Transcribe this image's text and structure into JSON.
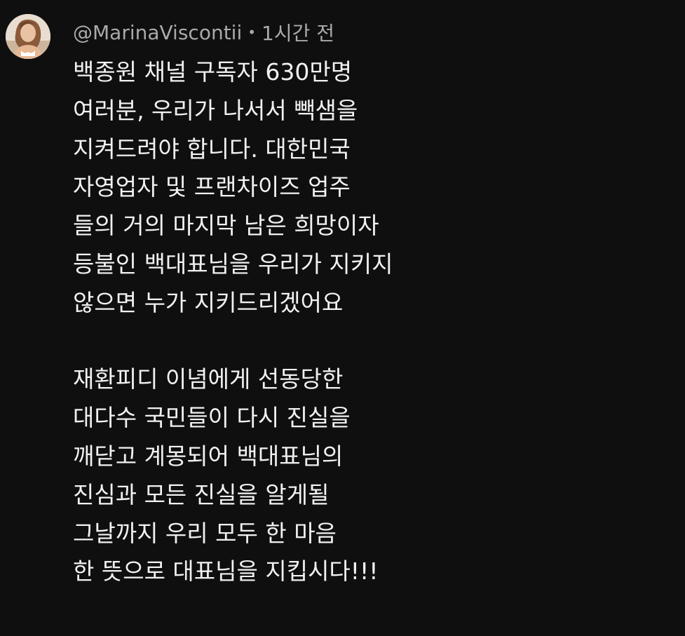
{
  "comment": {
    "author": "@MarinaViscontii",
    "separator": "•",
    "time": "1시간 전",
    "avatar_icon": "user-avatar-photo",
    "paragraph1": [
      "백종원 채널 구독자 630만명",
      "여러분, 우리가 나서서 빽샘을",
      "지켜드려야 합니다. 대한민국",
      "자영업자 및 프랜차이즈 업주",
      "들의 거의 마지막 남은 희망이자",
      "등불인 백대표님을 우리가 지키지",
      "않으면 누가 지키드리겠어요"
    ],
    "paragraph2": [
      "재환피디 이념에게 선동당한",
      "대다수 국민들이 다시 진실을",
      "깨닫고 계몽되어 백대표님의",
      "진심과 모든 진실을 알게될",
      "그날까지 우리 모두 한 마음",
      "한 뜻으로 대표님을 지킵시다!!!"
    ]
  },
  "colors": {
    "background": "#0f0f0f",
    "text_primary": "#f1f1f1",
    "text_secondary": "#aaaaaa"
  }
}
